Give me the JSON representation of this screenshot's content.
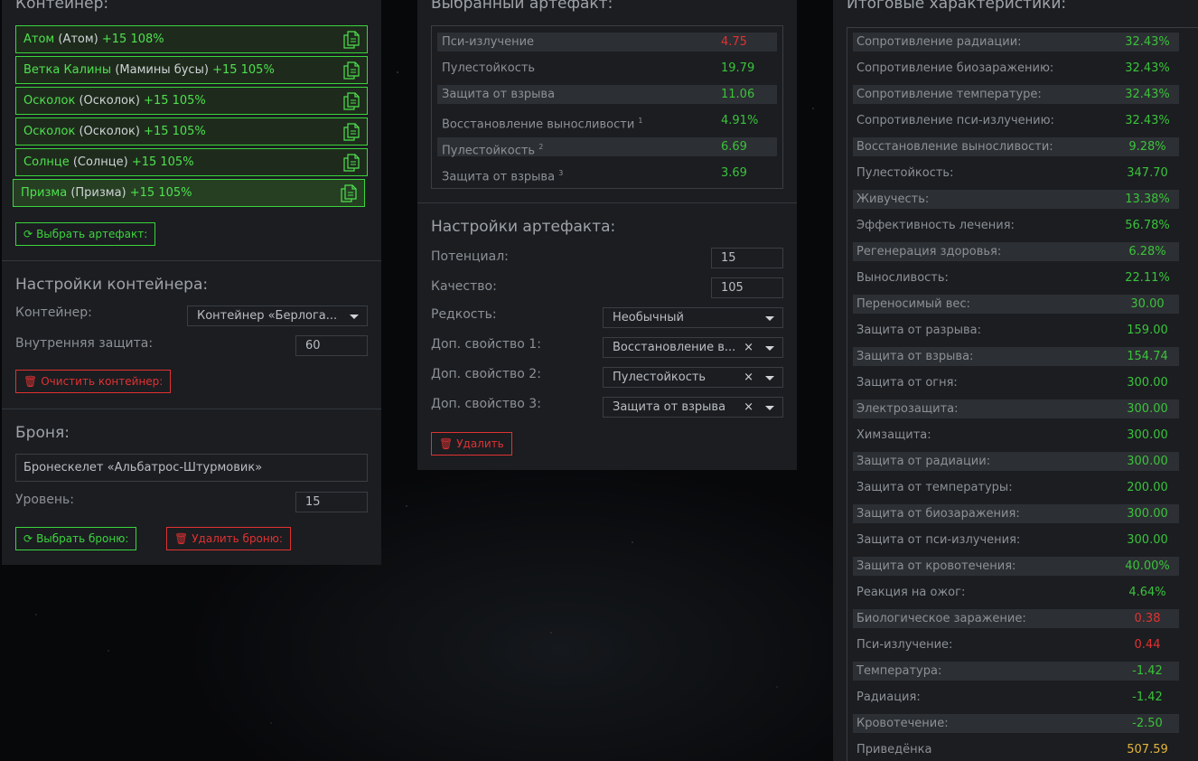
{
  "container": {
    "title": "Контейнер:",
    "artifacts": [
      {
        "name": "Атом",
        "alt": "(Атом)",
        "bonus": "+15 108%"
      },
      {
        "name": "Ветка Калины",
        "alt": "(Мамины бусы)",
        "bonus": "+15 105%"
      },
      {
        "name": "Осколок",
        "alt": "(Осколок)",
        "bonus": "+15 105%"
      },
      {
        "name": "Осколок",
        "alt": "(Осколок)",
        "bonus": "+15 105%"
      },
      {
        "name": "Солнце",
        "alt": "(Солнце)",
        "bonus": "+15 105%"
      },
      {
        "name": "Призма",
        "alt": "(Призма)",
        "bonus": "+15 105%"
      }
    ],
    "select_button": "Выбрать артефакт:"
  },
  "container_settings": {
    "title": "Настройки контейнера:",
    "container_label": "Контейнер:",
    "container_value": "Контейнер «Берлога...",
    "inner_protection_label": "Внутренняя защита:",
    "inner_protection_value": "60",
    "clear_button": "Очистить контейнер:"
  },
  "armor": {
    "title": "Броня:",
    "name": "Бронескелет «Альбатрос-Штурмовик»",
    "level_label": "Уровень:",
    "level_value": "15",
    "select_button": "Выбрать броню:",
    "delete_button": "Удалить броню:"
  },
  "selected_artifact": {
    "title": "Выбранный артефакт:",
    "stats": [
      {
        "label": "Пси-излучение",
        "sup": "",
        "value": "4.75",
        "color": "red"
      },
      {
        "label": "Пулестойкость",
        "sup": "",
        "value": "19.79",
        "color": "green"
      },
      {
        "label": "Защита от взрыва",
        "sup": "",
        "value": "11.06",
        "color": "green"
      },
      {
        "label": "Восстановление выносливости",
        "sup": "1",
        "value": "4.91%",
        "color": "green"
      },
      {
        "label": "Пулестойкость",
        "sup": "2",
        "value": "6.69",
        "color": "green"
      },
      {
        "label": "Защита от взрыва",
        "sup": "3",
        "value": "3.69",
        "color": "green"
      }
    ]
  },
  "artifact_settings": {
    "title": "Настройки артефакта:",
    "potential_label": "Потенциал:",
    "potential_value": "15",
    "quality_label": "Качество:",
    "quality_value": "105",
    "rarity_label": "Редкость:",
    "rarity_value": "Необычный",
    "extra1_label": "Доп. свойство 1:",
    "extra1_value": "Восстановление в...",
    "extra2_label": "Доп. свойство 2:",
    "extra2_value": "Пулестойкость",
    "extra3_label": "Доп. свойство 3:",
    "extra3_value": "Защита от взрыва",
    "delete_button": "Удалить",
    "clear_symbol": "×"
  },
  "totals": {
    "title": "Итоговые характеристики:",
    "rows": [
      {
        "label": "Сопротивление радиации:",
        "value": "32.43%",
        "color": "green"
      },
      {
        "label": "Сопротивление биозаражению:",
        "value": "32.43%",
        "color": "green"
      },
      {
        "label": "Сопротивление температуре:",
        "value": "32.43%",
        "color": "green"
      },
      {
        "label": "Сопротивление пси-излучению:",
        "value": "32.43%",
        "color": "green"
      },
      {
        "label": "Восстановление выносливости:",
        "value": "9.28%",
        "color": "green"
      },
      {
        "label": "Пулестойкость:",
        "value": "347.70",
        "color": "green"
      },
      {
        "label": "Живучесть:",
        "value": "13.38%",
        "color": "green"
      },
      {
        "label": "Эффективность лечения:",
        "value": "56.78%",
        "color": "green"
      },
      {
        "label": "Регенерация здоровья:",
        "value": "6.28%",
        "color": "green"
      },
      {
        "label": "Выносливость:",
        "value": "22.11%",
        "color": "green"
      },
      {
        "label": "Переносимый вес:",
        "value": "30.00",
        "color": "green"
      },
      {
        "label": "Защита от разрыва:",
        "value": "159.00",
        "color": "green"
      },
      {
        "label": "Защита от взрыва:",
        "value": "154.74",
        "color": "green"
      },
      {
        "label": "Защита от огня:",
        "value": "300.00",
        "color": "green"
      },
      {
        "label": "Электрозащита:",
        "value": "300.00",
        "color": "green"
      },
      {
        "label": "Химзащита:",
        "value": "300.00",
        "color": "green"
      },
      {
        "label": "Защита от радиации:",
        "value": "300.00",
        "color": "green"
      },
      {
        "label": "Защита от температуры:",
        "value": "200.00",
        "color": "green"
      },
      {
        "label": "Защита от биозаражения:",
        "value": "300.00",
        "color": "green"
      },
      {
        "label": "Защита от пси-излучения:",
        "value": "300.00",
        "color": "green"
      },
      {
        "label": "Защита от кровотечения:",
        "value": "40.00%",
        "color": "green"
      },
      {
        "label": "Реакция на ожог:",
        "value": "4.64%",
        "color": "green"
      },
      {
        "label": "Биологическое заражение:",
        "value": "0.38",
        "color": "red"
      },
      {
        "label": "Пси-излучение:",
        "value": "0.44",
        "color": "red"
      },
      {
        "label": "Температура:",
        "value": "-1.42",
        "color": "green"
      },
      {
        "label": "Радиация:",
        "value": "-1.42",
        "color": "green"
      },
      {
        "label": "Кровотечение:",
        "value": "-2.50",
        "color": "green"
      },
      {
        "label": "Приведёнка",
        "value": "507.59",
        "color": "yellow"
      }
    ]
  }
}
